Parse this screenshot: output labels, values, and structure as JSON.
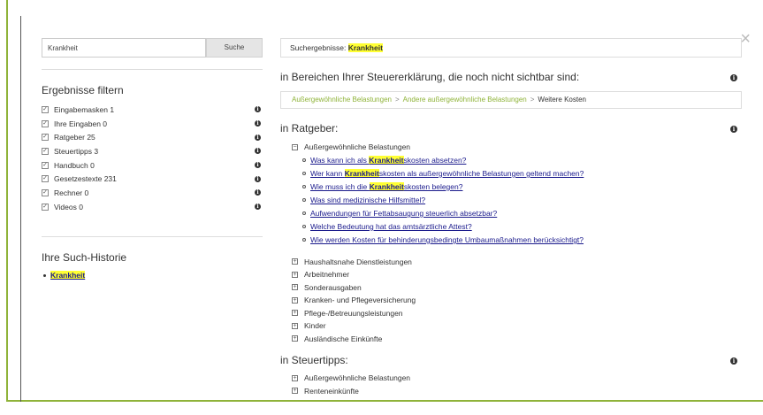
{
  "search": {
    "value": "Krankheit",
    "button_label": "Suche"
  },
  "close_glyph": "×",
  "filters": {
    "title": "Ergebnisse filtern",
    "items": [
      {
        "label": "Eingabemasken 1"
      },
      {
        "label": "Ihre Eingaben 0"
      },
      {
        "label": "Ratgeber 25"
      },
      {
        "label": "Steuertipps 3"
      },
      {
        "label": "Handbuch 0"
      },
      {
        "label": "Gesetzestexte 231"
      },
      {
        "label": "Rechner 0"
      },
      {
        "label": "Videos 0"
      }
    ]
  },
  "history": {
    "title": "Ihre Such-Historie",
    "items": [
      "Krankheit"
    ]
  },
  "results": {
    "prefix": "Suchergebnisse:",
    "term": "Krankheit",
    "section_hidden": {
      "title": "in Bereichen Ihrer Steuererklärung, die noch nicht sichtbar sind:",
      "breadcrumb": [
        "Außergewöhnliche Belastungen",
        "Andere außergewöhnliche Belastungen",
        "Weitere Kosten"
      ]
    },
    "ratgeber": {
      "title": "in Ratgeber:",
      "open_category": "Außergewöhnliche Belastungen",
      "links": [
        {
          "pre": "Was kann ich als ",
          "hl": "Krankheit",
          "post": "skosten absetzen?"
        },
        {
          "pre": "Wer kann ",
          "hl": "Krankheit",
          "post": "skosten als außergewöhnliche Belastungen geltend machen?"
        },
        {
          "pre": "Wie muss ich die ",
          "hl": "Krankheit",
          "post": "skosten belegen?"
        },
        {
          "pre": "Was sind medizinische Hilfsmittel?",
          "hl": "",
          "post": ""
        },
        {
          "pre": "Aufwendungen für Fettabsaugung steuerlich absetzbar?",
          "hl": "",
          "post": ""
        },
        {
          "pre": "Welche Bedeutung hat das amtsärztliche Attest?",
          "hl": "",
          "post": ""
        },
        {
          "pre": "Wie werden Kosten für behinderungsbedingte Umbaumaßnahmen berücksichtigt?",
          "hl": "",
          "post": ""
        }
      ],
      "closed_categories": [
        "Haushaltsnahe Dienstleistungen",
        "Arbeitnehmer",
        "Sonderausgaben",
        "Kranken- und Pflegeversicherung",
        "Pflege-/Betreuungsleistungen",
        "Kinder",
        "Ausländische Einkünfte"
      ]
    },
    "steuertipps": {
      "title": "in Steuertipps:",
      "closed_categories": [
        "Außergewöhnliche Belastungen",
        "Renteneinkünfte"
      ]
    }
  },
  "colors": {
    "accent": "#8fb339",
    "highlight": "#ffff33",
    "link": "#1a1a8c"
  }
}
